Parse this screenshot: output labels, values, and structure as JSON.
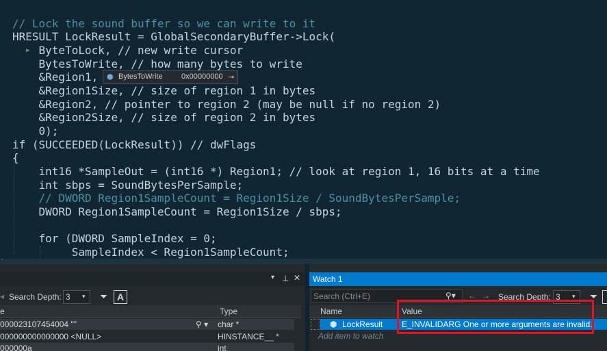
{
  "editor": {
    "lines": [
      {
        "t": "// Lock the sound buffer so we can write to it"
      },
      {
        "t": "HRESULT LockResult = GlobalSecondaryBuffer->Lock("
      },
      {
        "t": "    ByteToLock, // new write cursor"
      },
      {
        "t": "    BytesToWrite, // how many bytes to write"
      },
      {
        "t": "    &Region1, /"
      },
      {
        "t": "    &Region1Size, // size of region 1 in bytes"
      },
      {
        "t": "    &Region2, // pointer to region 2 (may be null if no region 2)"
      },
      {
        "t": "    &Region2Size, // size of region 2 in bytes"
      },
      {
        "t": "    0);"
      },
      {
        "t": "if (SUCCEEDED(LockResult)) // dwFlags"
      },
      {
        "t": "{"
      },
      {
        "t": "    int16 *SampleOut = (int16 *) Region1; // look at region 1, 16 bits at a time"
      },
      {
        "t": "    int sbps = SoundBytesPerSample;"
      },
      {
        "t": "    // DWORD Region1SampleCount = Region1Size / SoundBytesPerSample;"
      },
      {
        "t": "    DWORD Region1SampleCount = Region1Size / sbps;"
      },
      {
        "t": ""
      },
      {
        "t": "    for (DWORD SampleIndex = 0;"
      },
      {
        "t": "         SampleIndex < Region1SampleCount;"
      }
    ],
    "tooltip": {
      "name": "BytesToWrite",
      "value": "0x00000000"
    }
  },
  "left_panel": {
    "search_depth_label": "Search Depth:",
    "search_depth_value": "3",
    "columns": {
      "name": "e",
      "type": "Type"
    },
    "rows": [
      {
        "value": "000023107454004 \"\"",
        "type": "char *"
      },
      {
        "value": "000000000000000 <NULL>",
        "type": "HINSTANCE__ *"
      },
      {
        "value": "000000a",
        "type": "int"
      }
    ]
  },
  "watch": {
    "title": "Watch 1",
    "search_placeholder": "Search (Ctrl+E)",
    "search_depth_label": "Search Depth:",
    "search_depth_value": "3",
    "columns": {
      "name": "Name",
      "value": "Value"
    },
    "rows": [
      {
        "name": "LockResult",
        "value": "E_INVALIDARG One or more arguments are invalid."
      }
    ],
    "add_item": "Add item to watch"
  },
  "colors": {
    "selection": "#007acc",
    "highlight_box": "#e81123"
  }
}
